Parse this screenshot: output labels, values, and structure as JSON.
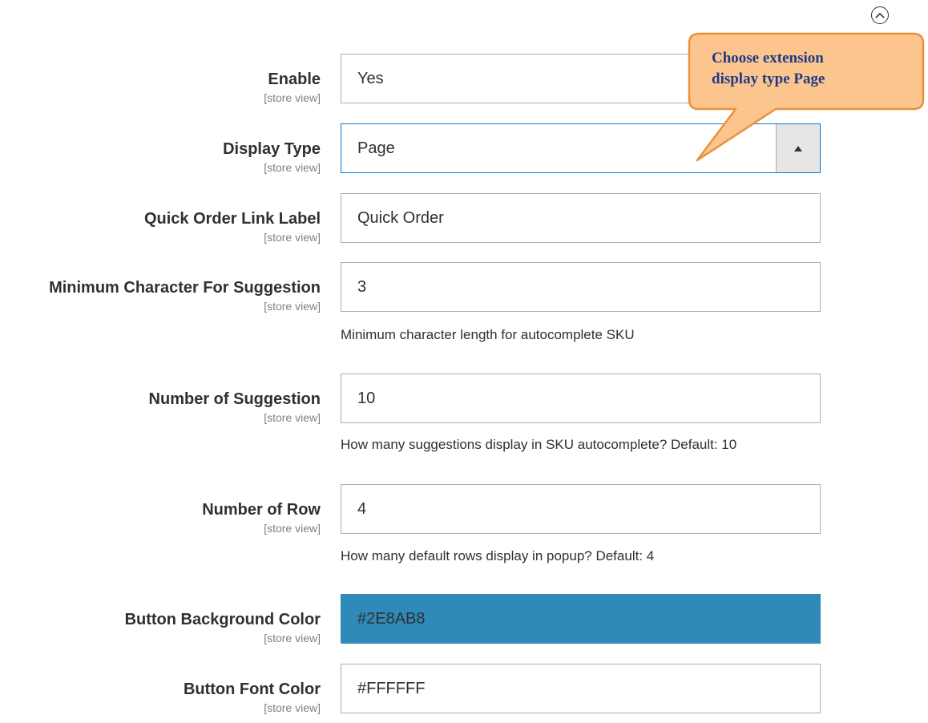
{
  "section": {
    "collapse_icon": "chevron-up-circle-icon"
  },
  "fields": {
    "enable": {
      "label": "Enable",
      "scope": "[store view]",
      "value": "Yes"
    },
    "display_type": {
      "label": "Display Type",
      "scope": "[store view]",
      "value": "Page",
      "arrow_icon": "triangle-up-icon"
    },
    "quick_order_link_label": {
      "label": "Quick Order Link Label",
      "scope": "[store view]",
      "value": "Quick Order"
    },
    "minimum_character": {
      "label": "Minimum Character For Suggestion",
      "scope": "[store view]",
      "value": "3",
      "note": "Minimum character length for autocomplete SKU"
    },
    "number_of_suggestion": {
      "label": "Number of Suggestion",
      "scope": "[store view]",
      "value": "10",
      "note": "How many suggestions display in SKU autocomplete? Default: 10"
    },
    "number_of_row": {
      "label": "Number of Row",
      "scope": "[store view]",
      "value": "4",
      "note": "How many default rows display in popup? Default: 4"
    },
    "button_background_color": {
      "label": "Button Background Color",
      "scope": "[store view]",
      "value": "#2E8AB8",
      "swatch": "#2e8ab8"
    },
    "button_font_color": {
      "label": "Button Font Color",
      "scope": "[store view]",
      "value": "#FFFFFF"
    }
  },
  "callout": {
    "line1": "Choose extension",
    "line2": "display type Page",
    "fill": "#fbc58d",
    "stroke": "#e8923a",
    "text_color": "#1f3a8a"
  },
  "colors": {
    "focus_border": "#007bdb",
    "field_border": "#adadad",
    "select_arrow_bg": "#e6e6e6"
  }
}
